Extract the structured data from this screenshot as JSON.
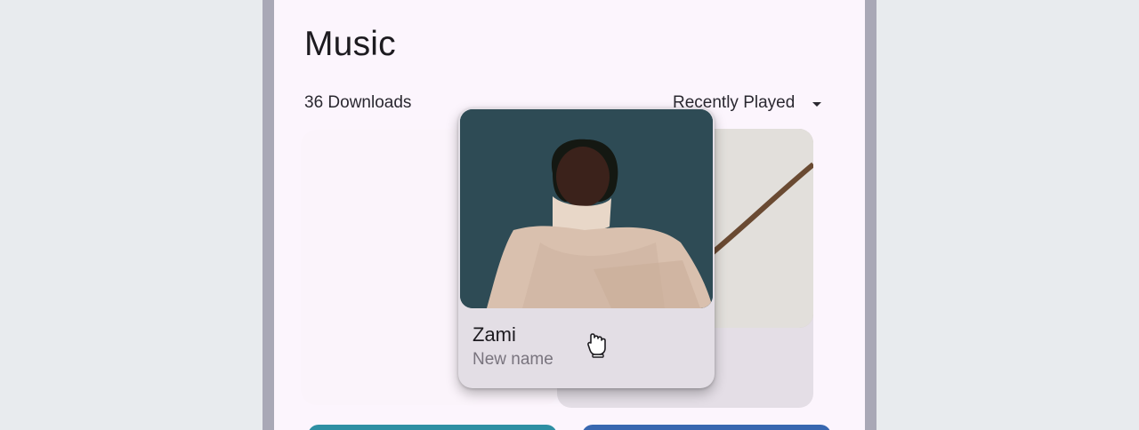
{
  "header": {
    "title": "Music",
    "downloads": "36 Downloads",
    "sort_label": "Recently Played"
  },
  "cards": {
    "dragged": {
      "title": "Zami",
      "subtitle": "New name"
    }
  },
  "colors": {
    "panel": "#fcf5fd",
    "card": "#e3dee5",
    "art_bg": "#2e4b55"
  }
}
